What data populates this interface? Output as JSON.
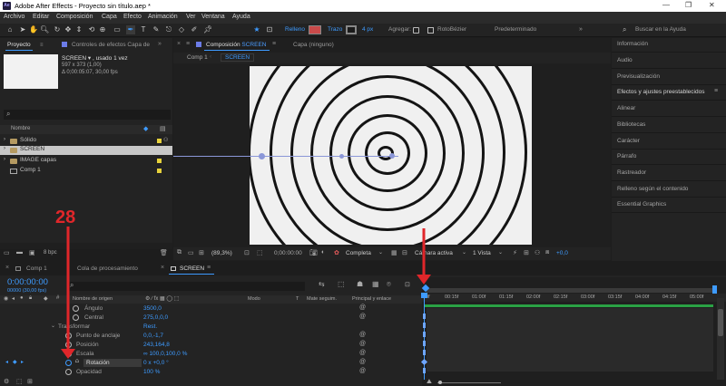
{
  "titlebar": {
    "title": "Adobe After Effects - Proyecto sin título.aep *",
    "app_icon": "Ae",
    "minimize": "—",
    "restore": "❐",
    "close": "✕"
  },
  "menu": [
    "Archivo",
    "Editar",
    "Composición",
    "Capa",
    "Efecto",
    "Animación",
    "Ver",
    "Ventana",
    "Ayuda"
  ],
  "toolbar": {
    "fill_label": "Relleno",
    "stroke_label": "Trazo",
    "stroke_width": "4 px",
    "add_label": "Agregar:",
    "rotobezier_label": "RotoBézier",
    "workspace": "Predeterminado",
    "search_placeholder": "Buscar en la Ayuda"
  },
  "project": {
    "tab": "Proyecto",
    "effects_tab": "Controles de efectos Capa de",
    "item_name": "SCREEN ▾ , usado 1 vez",
    "item_dims": "597 x 373 (1,00)",
    "item_duration": "Δ 0;00:05:07, 30,00 fps",
    "col_name": "Nombre",
    "items": [
      {
        "name": "Sólido",
        "type": "folder"
      },
      {
        "name": "SCREEN",
        "type": "folder"
      },
      {
        "name": "IMAGE capas",
        "type": "folder"
      },
      {
        "name": "Comp 1",
        "type": "comp"
      }
    ],
    "bpc": "8 bpc"
  },
  "comp": {
    "tab_prefix": "Composición",
    "tab_name": "SCREEN",
    "layer_tab": "Capa (ninguno)",
    "crumb_comp1": "Comp 1",
    "crumb_screen": "SCREEN",
    "zoom": "(89,3%)",
    "timecode": "0;00:00:00",
    "resolution": "Completa",
    "camera": "Cámara activa",
    "views": "1 Vista",
    "exposure": "+0,0"
  },
  "right_panel": [
    "Información",
    "Audio",
    "Previsualización",
    "Efectos y ajustes preestablecidos",
    "Alinear",
    "Bibliotecas",
    "Carácter",
    "Párrafo",
    "Rastreador",
    "Relleno según el contenido",
    "Essential Graphics"
  ],
  "timeline": {
    "tabs": [
      "Comp 1",
      "Cola de procesamiento",
      "SCREEN"
    ],
    "timecode": "0:00:00:00",
    "frame_info": "00000 (30,00 fps)",
    "search_placeholder": "",
    "col_source": "Nombre de origen",
    "col_mode": "Modo",
    "col_t": "T",
    "col_matte": "Mate seguim.",
    "col_parent": "Principal y enlace",
    "ruler": [
      "0f",
      "00:15f",
      "01:00f",
      "01:15f",
      "02:00f",
      "02:15f",
      "03:00f",
      "03:15f",
      "04:00f",
      "04:15f",
      "05:00f"
    ],
    "rows": [
      {
        "label": "Ángulo",
        "value": "3500,0"
      },
      {
        "label": "Central",
        "value": "275,0,0,0"
      },
      {
        "label": "Transformar",
        "value": "Rest."
      },
      {
        "label": "Punto de anclaje",
        "value": "0,0,-1,7"
      },
      {
        "label": "Posición",
        "value": "243,164,8"
      },
      {
        "label": "Escala",
        "value": "∞ 100,0,100,0 %"
      },
      {
        "label": "Rotación",
        "value": "0 x +0,0 °"
      },
      {
        "label": "Opacidad",
        "value": "100 %"
      }
    ]
  },
  "annotation": {
    "label": "28",
    "color": "#e0262a"
  },
  "colors": {
    "accent": "#3e9bff",
    "annotation": "#e0262a",
    "fill_swatch": "#c94a4a"
  }
}
